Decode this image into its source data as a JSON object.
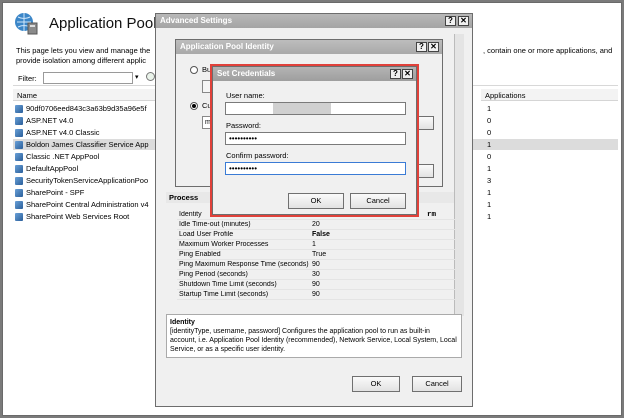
{
  "iis": {
    "title": "Application Pools",
    "intro_line1": "This page lets you view and manage the",
    "intro_line2": "provide isolation among different applic",
    "intro_right": ", contain one or more applications, and",
    "filter_label": "Filter:",
    "col_name": "Name",
    "col_applications": "Applications",
    "pools": [
      {
        "name": "90df0706eed843c3a63b9d35a96e5f",
        "apps": "1"
      },
      {
        "name": "ASP.NET v4.0",
        "apps": "0"
      },
      {
        "name": "ASP.NET v4.0 Classic",
        "apps": "0"
      },
      {
        "name": "Boldon James Classifier Service App",
        "apps": "1"
      },
      {
        "name": "Classic .NET AppPool",
        "apps": "0"
      },
      {
        "name": "DefaultAppPool",
        "apps": "1"
      },
      {
        "name": "SecurityTokenServiceApplicationPoo",
        "apps": "3"
      },
      {
        "name": "SharePoint - SPF",
        "apps": "1"
      },
      {
        "name": "SharePoint Central Administration v4",
        "apps": "1"
      },
      {
        "name": "SharePoint Web Services Root",
        "apps": "1"
      }
    ]
  },
  "advanced": {
    "title": "Advanced Settings",
    "section_process": "Process",
    "identity_value_fragment": "rm",
    "properties": [
      {
        "key": "Identity",
        "value": ""
      },
      {
        "key": "Idle Time-out (minutes)",
        "value": "20"
      },
      {
        "key": "Load User Profile",
        "value": "False"
      },
      {
        "key": "Maximum Worker Processes",
        "value": "1"
      },
      {
        "key": "Ping Enabled",
        "value": "True"
      },
      {
        "key": "Ping Maximum Response Time (seconds)",
        "value": "90"
      },
      {
        "key": "Ping Period (seconds)",
        "value": "30"
      },
      {
        "key": "Shutdown Time Limit (seconds)",
        "value": "90"
      },
      {
        "key": "Startup Time Limit (seconds)",
        "value": "90"
      }
    ],
    "desc_title": "Identity",
    "desc_text": "[identityType, username, password] Configures the application pool to run as built-in account, i.e. Application Pool Identity (recommended), Network Service, Local System, Local Service, or as a specific user identity.",
    "ok": "OK",
    "cancel": "Cancel"
  },
  "identity": {
    "title": "Application Pool Identity",
    "radio1_fragment": "Buil",
    "radio2_fragment": "Cus",
    "field_fragment": "mo"
  },
  "creds": {
    "title": "Set Credentials",
    "username_label": "User name:",
    "username_value": "",
    "password_label": "Password:",
    "password_value": "••••••••••",
    "confirm_label": "Confirm password:",
    "confirm_value": "••••••••••",
    "ok": "OK",
    "cancel": "Cancel"
  },
  "highlight_color": "#e0413a"
}
